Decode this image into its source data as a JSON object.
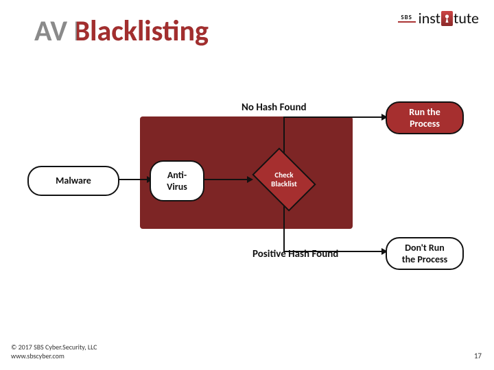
{
  "title": "AV Blacklisting",
  "logo": {
    "sbs": "SBS",
    "inst_pre": "inst",
    "inst_post": "tute"
  },
  "nodes": {
    "malware": "Malware",
    "antivirus": "Anti-\nVirus",
    "check_blacklist": "Check\nBlacklist",
    "run_process": "Run the\nProcess",
    "dont_run_process": "Don't Run\nthe Process"
  },
  "labels": {
    "no_hash": "No Hash Found",
    "positive_hash": "Positive Hash Found"
  },
  "footer": {
    "copyright": "© 2017 SBS Cyber.Security, LLC",
    "url": "www.sbscyber.com",
    "page": "17"
  },
  "colors": {
    "brand_red": "#a62f2f",
    "bg_block": "#7d2525"
  }
}
